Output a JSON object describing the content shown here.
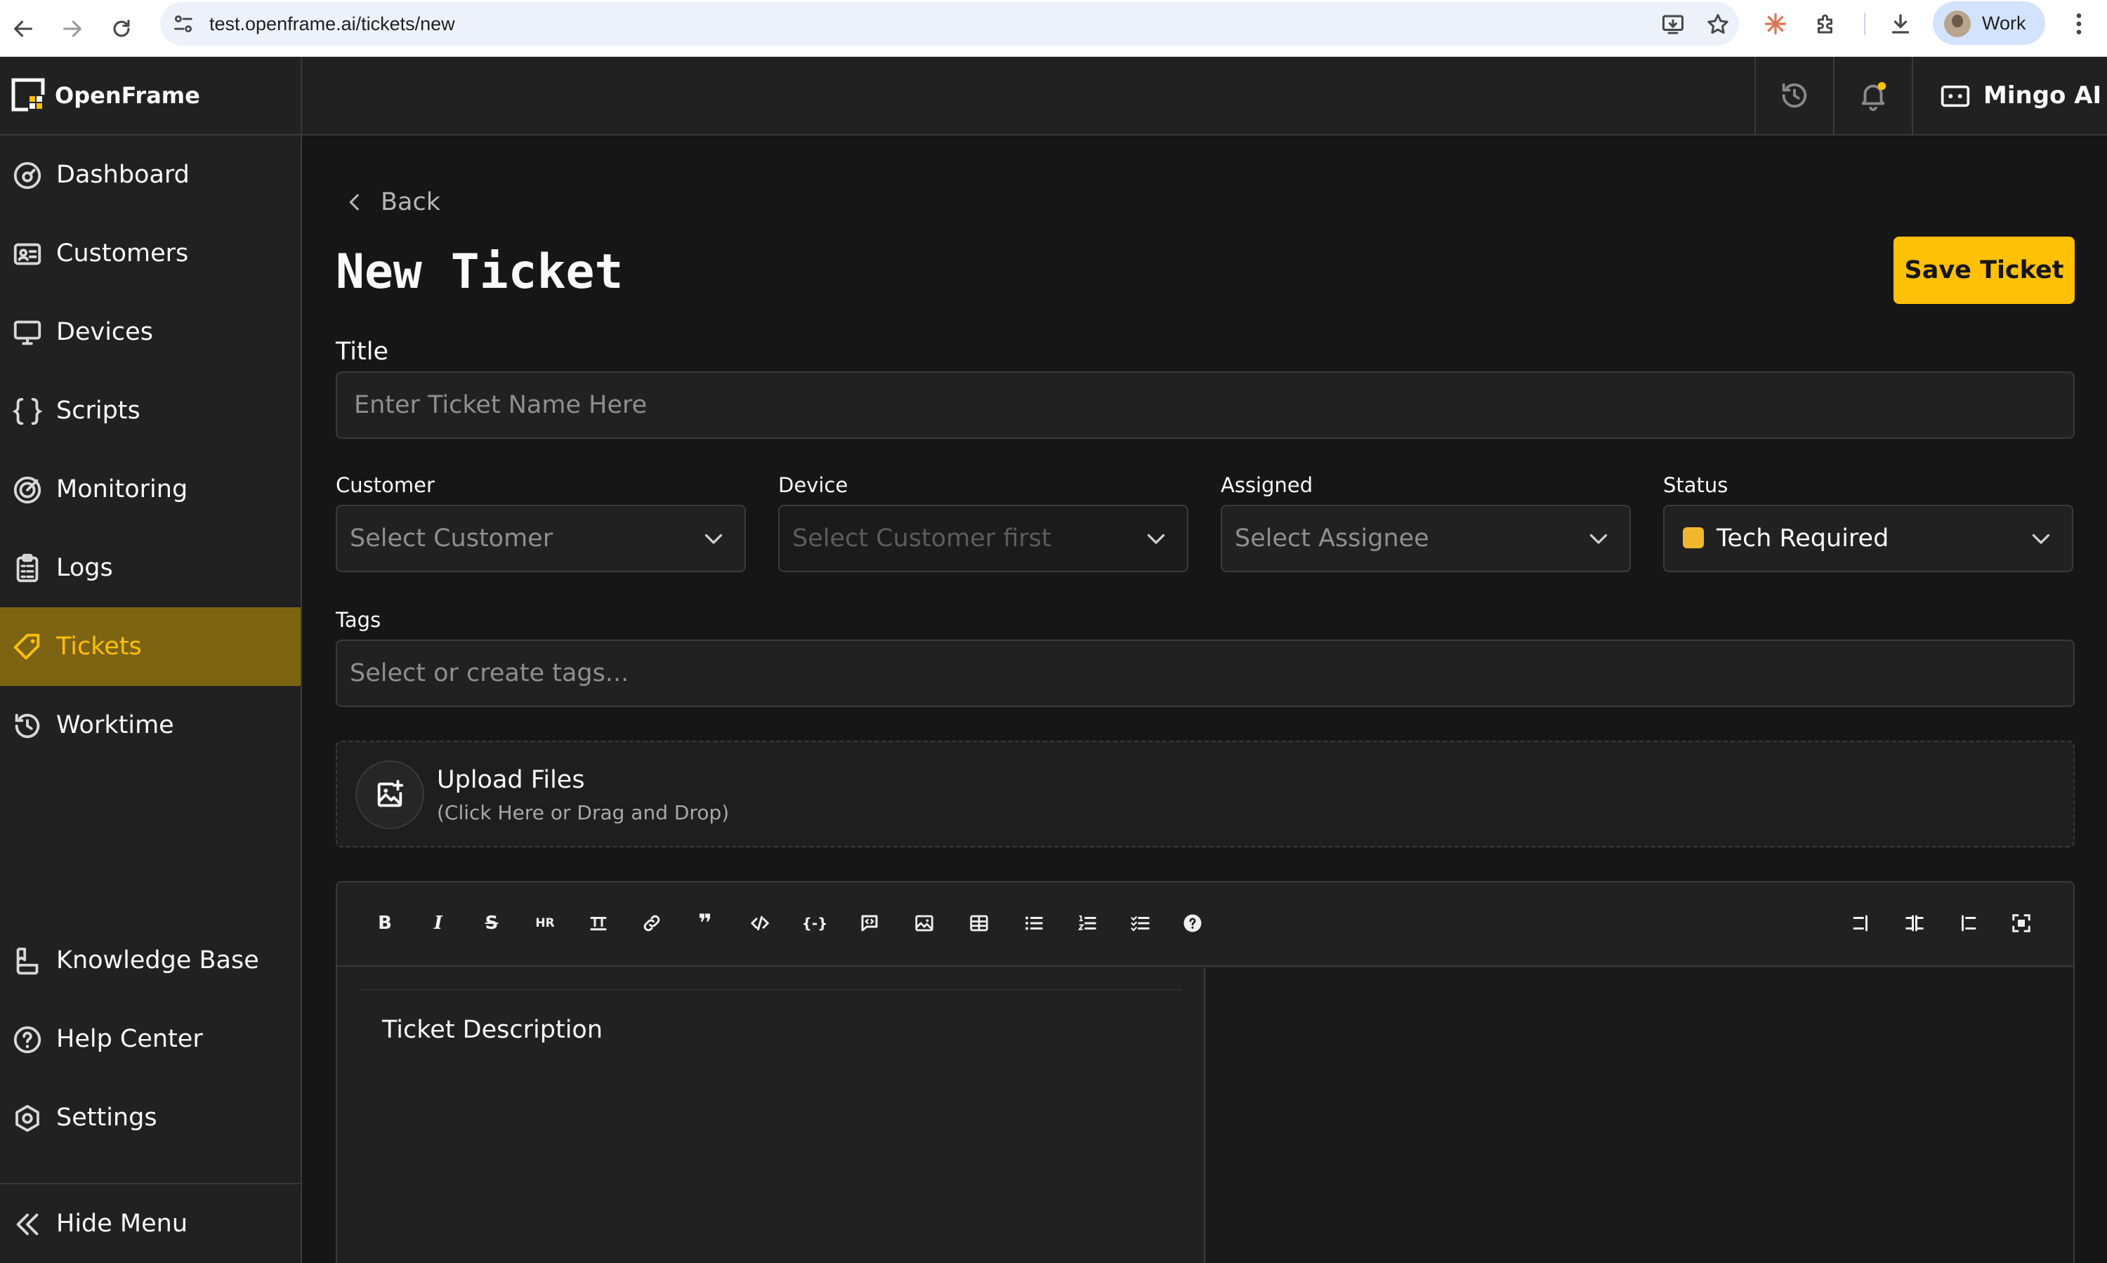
{
  "browser": {
    "url": "test.openframe.ai/tickets/new",
    "profile_label": "Work"
  },
  "app": {
    "brand": "OpenFrame",
    "mingo_label": "Mingo AI"
  },
  "sidebar": {
    "items": [
      {
        "label": "Dashboard",
        "icon": "dashboard-icon"
      },
      {
        "label": "Customers",
        "icon": "customers-icon"
      },
      {
        "label": "Devices",
        "icon": "devices-icon"
      },
      {
        "label": "Scripts",
        "icon": "scripts-icon"
      },
      {
        "label": "Monitoring",
        "icon": "monitoring-icon"
      },
      {
        "label": "Logs",
        "icon": "logs-icon"
      },
      {
        "label": "Tickets",
        "icon": "tickets-icon",
        "active": true
      },
      {
        "label": "Worktime",
        "icon": "worktime-icon"
      }
    ],
    "bottom_items": [
      {
        "label": "Knowledge Base",
        "icon": "knowledge-base-icon"
      },
      {
        "label": "Help Center",
        "icon": "help-center-icon"
      },
      {
        "label": "Settings",
        "icon": "settings-icon"
      }
    ],
    "hide_menu": "Hide Menu"
  },
  "page": {
    "back_label": "Back",
    "title": "New Ticket",
    "save_label": "Save Ticket"
  },
  "form": {
    "title_label": "Title",
    "title_placeholder": "Enter Ticket Name Here",
    "customer_label": "Customer",
    "customer_placeholder": "Select Customer",
    "device_label": "Device",
    "device_placeholder": "Select Customer first",
    "assigned_label": "Assigned",
    "assigned_placeholder": "Select Assignee",
    "status_label": "Status",
    "status_value": "Tech Required",
    "tags_label": "Tags",
    "tags_placeholder": "Select or create tags..."
  },
  "upload": {
    "title": "Upload Files",
    "subtitle": "(Click Here or Drag and Drop)"
  },
  "editor": {
    "placeholder": "Ticket Description",
    "tools": [
      "bold",
      "italic",
      "strikethrough",
      "horizontal-rule",
      "title",
      "link",
      "quote",
      "code",
      "code-block",
      "comment",
      "image",
      "table",
      "unordered-list",
      "ordered-list",
      "checklist",
      "help"
    ],
    "view_tools": [
      "edit-only",
      "split-view",
      "preview-only",
      "fullscreen"
    ]
  },
  "colors": {
    "accent": "#ffc008",
    "active_bg": "#7d6413",
    "status_dot": "#f2b82d",
    "background": "#161616",
    "panel": "#212121"
  }
}
